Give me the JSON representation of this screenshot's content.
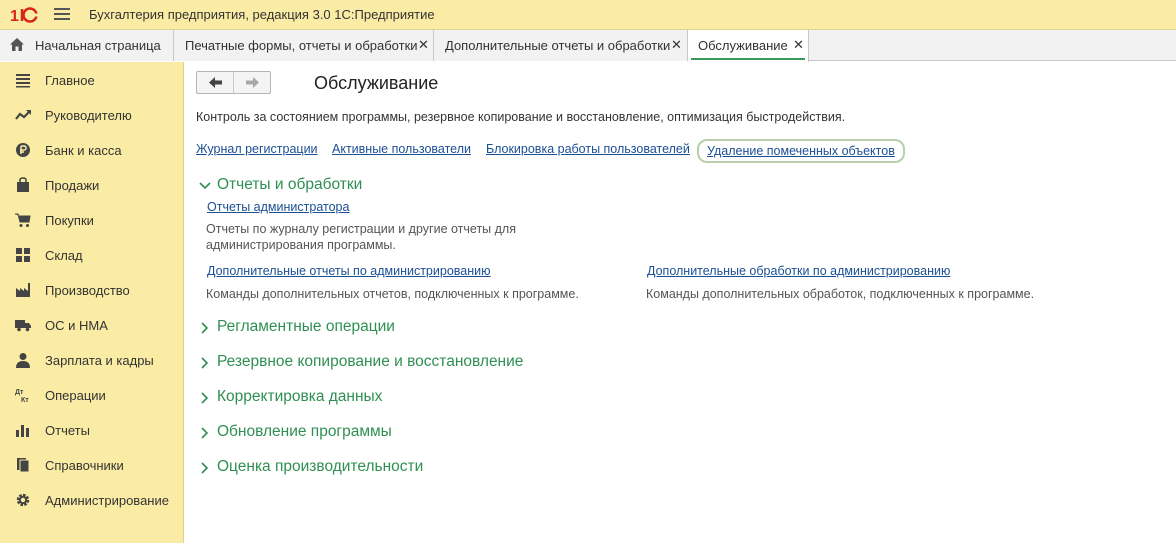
{
  "app": {
    "logo": "1С",
    "title": "Бухгалтерия предприятия, редакция 3.0 1С:Предприятие"
  },
  "tabs": {
    "home": "Начальная страница",
    "items": [
      {
        "label": "Печатные формы, отчеты и обработки"
      },
      {
        "label": "Дополнительные отчеты и обработки"
      },
      {
        "label": "Обслуживание"
      }
    ],
    "close_glyph": "✕"
  },
  "sidebar": {
    "items": [
      {
        "label": "Главное",
        "icon": "list-icon"
      },
      {
        "label": "Руководителю",
        "icon": "trend-icon"
      },
      {
        "label": "Банк и касса",
        "icon": "ruble-coin-icon"
      },
      {
        "label": "Продажи",
        "icon": "shopping-bag-icon"
      },
      {
        "label": "Покупки",
        "icon": "cart-icon"
      },
      {
        "label": "Склад",
        "icon": "warehouse-icon"
      },
      {
        "label": "Производство",
        "icon": "factory-icon"
      },
      {
        "label": "ОС и НМА",
        "icon": "truck-icon"
      },
      {
        "label": "Зарплата и кадры",
        "icon": "person-icon"
      },
      {
        "label": "Операции",
        "icon": "debit-credit-icon"
      },
      {
        "label": "Отчеты",
        "icon": "bar-chart-icon"
      },
      {
        "label": "Справочники",
        "icon": "books-icon"
      },
      {
        "label": "Администрирование",
        "icon": "gear-icon"
      }
    ]
  },
  "main": {
    "title": "Обслуживание",
    "description": "Контроль за состоянием программы, резервное копирование и восстановление, оптимизация быстродействия.",
    "links": [
      "Журнал регистрации",
      "Активные пользователи",
      "Блокировка работы пользователей",
      "Удаление помеченных объектов"
    ],
    "sections": [
      {
        "label": "Отчеты и обработки",
        "expanded": true,
        "items": [
          {
            "link": "Отчеты администратора",
            "desc_line1": "Отчеты по журналу регистрации и другие отчеты для",
            "desc_line2": "администрирования программы."
          },
          {
            "link": "Дополнительные отчеты по администрированию",
            "desc": "Команды дополнительных отчетов, подключенных к программе."
          },
          {
            "link": "Дополнительные обработки по администрированию",
            "desc": "Команды дополнительных обработок, подключенных к программе."
          }
        ]
      },
      {
        "label": "Регламентные операции",
        "expanded": false
      },
      {
        "label": "Резервное копирование и восстановление",
        "expanded": false
      },
      {
        "label": "Корректировка данных",
        "expanded": false
      },
      {
        "label": "Обновление программы",
        "expanded": false
      },
      {
        "label": "Оценка производительности",
        "expanded": false
      }
    ]
  },
  "colors": {
    "panel_yellow": "#fbeca5",
    "section_green": "#2f8f53",
    "link_blue": "#1c4f94",
    "highlight_border": "#b7d0a9"
  }
}
